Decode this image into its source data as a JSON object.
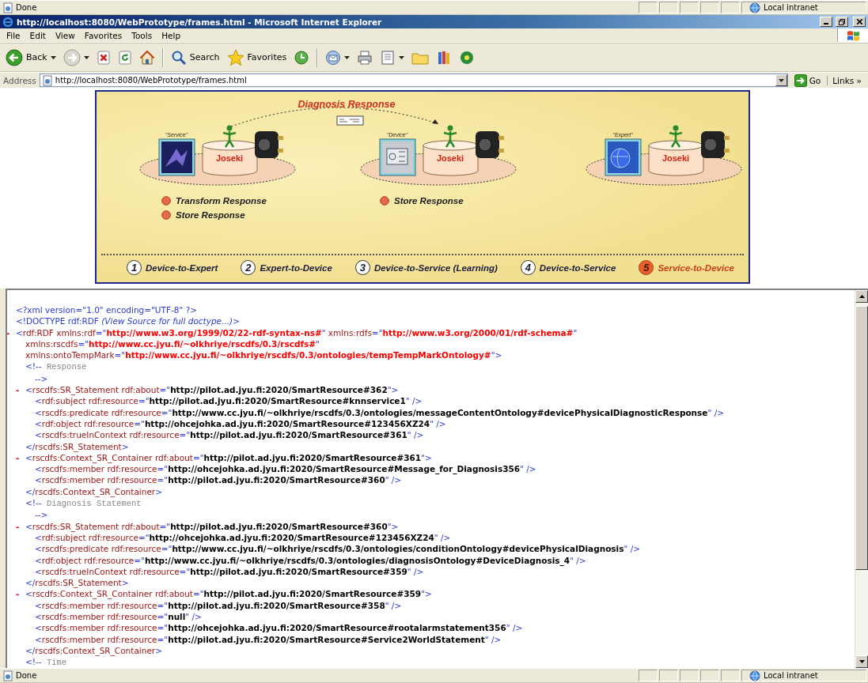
{
  "top_status_bar": {
    "text": "Done",
    "zone": "Local intranet"
  },
  "window": {
    "title": "http://localhost:8080/WebPrototype/frames.html - Microsoft Internet Explorer"
  },
  "menu": [
    "File",
    "Edit",
    "View",
    "Favorites",
    "Tools",
    "Help"
  ],
  "toolbar": [
    {
      "kind": "back",
      "label": "Back",
      "dropdown": true
    },
    {
      "kind": "forward",
      "dropdown": true
    },
    {
      "kind": "stop",
      "dropdown": false
    },
    {
      "kind": "refresh",
      "dropdown": false
    },
    {
      "kind": "home",
      "dropdown": false
    },
    {
      "kind": "separator"
    },
    {
      "kind": "search",
      "label": "Search",
      "dropdown": false
    },
    {
      "kind": "favorites",
      "label": "Favorites",
      "dropdown": false
    },
    {
      "kind": "history",
      "dropdown": false
    },
    {
      "kind": "separator"
    },
    {
      "kind": "mail",
      "dropdown": true
    },
    {
      "kind": "print",
      "dropdown": false
    },
    {
      "kind": "edit",
      "dropdown": true
    },
    {
      "kind": "folder",
      "dropdown": false
    },
    {
      "kind": "research",
      "dropdown": false
    },
    {
      "kind": "messenger",
      "dropdown": false
    }
  ],
  "address_bar": {
    "label": "Address",
    "value": "http://localhost:8080/WebPrototype/frames.html",
    "go": "Go",
    "links": "Links »"
  },
  "diagram": {
    "title": "Diagnosis Response",
    "nodes": [
      {
        "kind": "service",
        "role": "\"Service\"",
        "server": "Joseki",
        "actions": [
          "Transform Response",
          "Store Response"
        ]
      },
      {
        "kind": "device",
        "role": "\"Device\"",
        "server": "Joseki",
        "actions": [
          "Store Response"
        ]
      },
      {
        "kind": "expert",
        "role": "\"Expert\"",
        "server": "Joseki"
      }
    ],
    "steps": [
      {
        "number": "1",
        "label": "Device-to-Expert",
        "selected": false
      },
      {
        "number": "2",
        "label": "Expert-to-Device",
        "selected": false
      },
      {
        "number": "3",
        "label": "Device-to-Service (Learning)",
        "selected": false
      },
      {
        "number": "4",
        "label": "Device-to-Service",
        "selected": false
      },
      {
        "number": "5",
        "label": "Service-to-Device",
        "selected": true
      }
    ]
  },
  "xml_view": {
    "nodes": [
      {
        "lines": [
          [
            {
              "kind": "markup",
              "text": "<?xml version=\"1.0\" encoding=\"UTF-8\" ?>"
            }
          ]
        ]
      },
      {
        "lines": [
          [
            {
              "kind": "markup",
              "text": "<!DOCTYPE rdf:RDF "
            },
            {
              "kind": "note",
              "text": "(View Source for full doctype...)"
            },
            {
              "kind": "markup",
              "text": ">"
            }
          ]
        ]
      },
      {
        "toggle": "-",
        "lines": [
          [
            {
              "kind": "markup",
              "text": "<"
            },
            {
              "kind": "name",
              "text": "rdf:RDF xmlns:rdf"
            },
            {
              "kind": "markup",
              "text": "=\""
            },
            {
              "kind": "ns",
              "text": "http://www.w3.org/1999/02/22-rdf-syntax-ns#"
            },
            {
              "kind": "markup",
              "text": "\""
            },
            {
              "kind": "name",
              "text": " xmlns:rdfs"
            },
            {
              "kind": "markup",
              "text": "=\""
            },
            {
              "kind": "ns",
              "text": "http://www.w3.org/2000/01/rdf-schema#"
            },
            {
              "kind": "markup",
              "text": "\""
            }
          ],
          [
            {
              "kind": "name",
              "text": "xmlns:rscdfs"
            },
            {
              "kind": "markup",
              "text": "=\""
            },
            {
              "kind": "ns",
              "text": "http://www.cc.jyu.fi/~olkhriye/rscdfs/0.3/rscdfs#"
            },
            {
              "kind": "markup",
              "text": "\""
            }
          ],
          [
            {
              "kind": "name",
              "text": "xmlns:ontoTempMark"
            },
            {
              "kind": "markup",
              "text": "=\""
            },
            {
              "kind": "ns",
              "text": "http://www.cc.jyu.fi/~olkhriye/rscdfs/0.3/ontologies/tempTempMarkOntology#"
            },
            {
              "kind": "markup",
              "text": "\">"
            }
          ]
        ],
        "children": [
          {
            "lines": [
              [
                {
                  "kind": "markup",
                  "text": "<!--"
                },
                {
                  "kind": "comment",
                  "text": "  Response"
                }
              ],
              [
                {
                  "kind": "markup",
                  "text": "-->"
                }
              ]
            ]
          },
          {
            "toggle": "-",
            "lines": [
              [
                {
                  "kind": "markup",
                  "text": "<"
                },
                {
                  "kind": "name",
                  "text": "rscdfs:SR_Statement rdf:about"
                },
                {
                  "kind": "markup",
                  "text": "=\""
                },
                {
                  "kind": "value",
                  "text": "http://pilot.ad.jyu.fi:2020/SmartResource#362"
                },
                {
                  "kind": "markup",
                  "text": "\">"
                }
              ]
            ],
            "children": [
              {
                "lines": [
                  [
                    {
                      "kind": "markup",
                      "text": "<"
                    },
                    {
                      "kind": "name",
                      "text": "rdf:subject rdf:resource"
                    },
                    {
                      "kind": "markup",
                      "text": "=\""
                    },
                    {
                      "kind": "value",
                      "text": "http://pilot.ad.jyu.fi:2020/SmartResource#knnservice1"
                    },
                    {
                      "kind": "markup",
                      "text": "\" />"
                    }
                  ]
                ]
              },
              {
                "lines": [
                  [
                    {
                      "kind": "markup",
                      "text": "<"
                    },
                    {
                      "kind": "name",
                      "text": "rscdfs:predicate rdf:resource"
                    },
                    {
                      "kind": "markup",
                      "text": "=\""
                    },
                    {
                      "kind": "value",
                      "text": "http://www.cc.jyu.fi/~olkhriye/rscdfs/0.3/ontologies/messageContentOntology#devicePhysicalDiagnosticResponse"
                    },
                    {
                      "kind": "markup",
                      "text": "\" />"
                    }
                  ]
                ]
              },
              {
                "lines": [
                  [
                    {
                      "kind": "markup",
                      "text": "<"
                    },
                    {
                      "kind": "name",
                      "text": "rdf:object rdf:resource"
                    },
                    {
                      "kind": "markup",
                      "text": "=\""
                    },
                    {
                      "kind": "value",
                      "text": "http://ohcejohka.ad.jyu.fi:2020/SmartResource#123456XZ24"
                    },
                    {
                      "kind": "markup",
                      "text": "\" />"
                    }
                  ]
                ]
              },
              {
                "lines": [
                  [
                    {
                      "kind": "markup",
                      "text": "<"
                    },
                    {
                      "kind": "name",
                      "text": "rscdfs:trueInContext rdf:resource"
                    },
                    {
                      "kind": "markup",
                      "text": "=\""
                    },
                    {
                      "kind": "value",
                      "text": "http://pilot.ad.jyu.fi:2020/SmartResource#361"
                    },
                    {
                      "kind": "markup",
                      "text": "\" />"
                    }
                  ]
                ]
              }
            ],
            "close": [
              {
                "kind": "markup",
                "text": "</"
              },
              {
                "kind": "name",
                "text": "rscdfs:SR_Statement"
              },
              {
                "kind": "markup",
                "text": ">"
              }
            ]
          },
          {
            "toggle": "-",
            "lines": [
              [
                {
                  "kind": "markup",
                  "text": "<"
                },
                {
                  "kind": "name",
                  "text": "rscdfs:Context_SR_Container rdf:about"
                },
                {
                  "kind": "markup",
                  "text": "=\""
                },
                {
                  "kind": "value",
                  "text": "http://pilot.ad.jyu.fi:2020/SmartResource#361"
                },
                {
                  "kind": "markup",
                  "text": "\">"
                }
              ]
            ],
            "children": [
              {
                "lines": [
                  [
                    {
                      "kind": "markup",
                      "text": "<"
                    },
                    {
                      "kind": "name",
                      "text": "rscdfs:member rdf:resource"
                    },
                    {
                      "kind": "markup",
                      "text": "=\""
                    },
                    {
                      "kind": "value",
                      "text": "http://ohcejohka.ad.jyu.fi:2020/SmartResource#Message_for_Diagnosis356"
                    },
                    {
                      "kind": "markup",
                      "text": "\" />"
                    }
                  ]
                ]
              },
              {
                "lines": [
                  [
                    {
                      "kind": "markup",
                      "text": "<"
                    },
                    {
                      "kind": "name",
                      "text": "rscdfs:member rdf:resource"
                    },
                    {
                      "kind": "markup",
                      "text": "=\""
                    },
                    {
                      "kind": "value",
                      "text": "http://pilot.ad.jyu.fi:2020/SmartResource#360"
                    },
                    {
                      "kind": "markup",
                      "text": "\" />"
                    }
                  ]
                ]
              }
            ],
            "close": [
              {
                "kind": "markup",
                "text": "</"
              },
              {
                "kind": "name",
                "text": "rscdfs:Context_SR_Container"
              },
              {
                "kind": "markup",
                "text": ">"
              }
            ]
          },
          {
            "lines": [
              [
                {
                  "kind": "markup",
                  "text": "<!--"
                },
                {
                  "kind": "comment",
                  "text": "  Diagnosis Statement"
                }
              ],
              [
                {
                  "kind": "markup",
                  "text": "-->"
                }
              ]
            ]
          },
          {
            "toggle": "-",
            "lines": [
              [
                {
                  "kind": "markup",
                  "text": "<"
                },
                {
                  "kind": "name",
                  "text": "rscdfs:SR_Statement rdf:about"
                },
                {
                  "kind": "markup",
                  "text": "=\""
                },
                {
                  "kind": "value",
                  "text": "http://pilot.ad.jyu.fi:2020/SmartResource#360"
                },
                {
                  "kind": "markup",
                  "text": "\">"
                }
              ]
            ],
            "children": [
              {
                "lines": [
                  [
                    {
                      "kind": "markup",
                      "text": "<"
                    },
                    {
                      "kind": "name",
                      "text": "rdf:subject rdf:resource"
                    },
                    {
                      "kind": "markup",
                      "text": "=\""
                    },
                    {
                      "kind": "value",
                      "text": "http://ohcejohka.ad.jyu.fi:2020/SmartResource#123456XZ24"
                    },
                    {
                      "kind": "markup",
                      "text": "\" />"
                    }
                  ]
                ]
              },
              {
                "lines": [
                  [
                    {
                      "kind": "markup",
                      "text": "<"
                    },
                    {
                      "kind": "name",
                      "text": "rscdfs:predicate rdf:resource"
                    },
                    {
                      "kind": "markup",
                      "text": "=\""
                    },
                    {
                      "kind": "value",
                      "text": "http://www.cc.jyu.fi/~olkhriye/rscdfs/0.3/ontologies/conditionOntology#devicePhysicalDiagnosis"
                    },
                    {
                      "kind": "markup",
                      "text": "\" />"
                    }
                  ]
                ]
              },
              {
                "lines": [
                  [
                    {
                      "kind": "markup",
                      "text": "<"
                    },
                    {
                      "kind": "name",
                      "text": "rdf:object rdf:resource"
                    },
                    {
                      "kind": "markup",
                      "text": "=\""
                    },
                    {
                      "kind": "value",
                      "text": "http://www.cc.jyu.fi/~olkhriye/rscdfs/0.3/ontologies/diagnosisOntology#DeviceDiagnosis_4"
                    },
                    {
                      "kind": "markup",
                      "text": "\" />"
                    }
                  ]
                ]
              },
              {
                "lines": [
                  [
                    {
                      "kind": "markup",
                      "text": "<"
                    },
                    {
                      "kind": "name",
                      "text": "rscdfs:trueInContext rdf:resource"
                    },
                    {
                      "kind": "markup",
                      "text": "=\""
                    },
                    {
                      "kind": "value",
                      "text": "http://pilot.ad.jyu.fi:2020/SmartResource#359"
                    },
                    {
                      "kind": "markup",
                      "text": "\" />"
                    }
                  ]
                ]
              }
            ],
            "close": [
              {
                "kind": "markup",
                "text": "</"
              },
              {
                "kind": "name",
                "text": "rscdfs:SR_Statement"
              },
              {
                "kind": "markup",
                "text": ">"
              }
            ]
          },
          {
            "toggle": "-",
            "lines": [
              [
                {
                  "kind": "markup",
                  "text": "<"
                },
                {
                  "kind": "name",
                  "text": "rscdfs:Context_SR_Container rdf:about"
                },
                {
                  "kind": "markup",
                  "text": "=\""
                },
                {
                  "kind": "value",
                  "text": "http://pilot.ad.jyu.fi:2020/SmartResource#359"
                },
                {
                  "kind": "markup",
                  "text": "\">"
                }
              ]
            ],
            "children": [
              {
                "lines": [
                  [
                    {
                      "kind": "markup",
                      "text": "<"
                    },
                    {
                      "kind": "name",
                      "text": "rscdfs:member rdf:resource"
                    },
                    {
                      "kind": "markup",
                      "text": "=\""
                    },
                    {
                      "kind": "value",
                      "text": "http://pilot.ad.jyu.fi:2020/SmartResource#358"
                    },
                    {
                      "kind": "markup",
                      "text": "\" />"
                    }
                  ]
                ]
              },
              {
                "lines": [
                  [
                    {
                      "kind": "markup",
                      "text": "<"
                    },
                    {
                      "kind": "name",
                      "text": "rscdfs:member rdf:resource"
                    },
                    {
                      "kind": "markup",
                      "text": "=\""
                    },
                    {
                      "kind": "value",
                      "text": "null"
                    },
                    {
                      "kind": "markup",
                      "text": "\" />"
                    }
                  ]
                ]
              },
              {
                "lines": [
                  [
                    {
                      "kind": "markup",
                      "text": "<"
                    },
                    {
                      "kind": "name",
                      "text": "rscdfs:member rdf:resource"
                    },
                    {
                      "kind": "markup",
                      "text": "=\""
                    },
                    {
                      "kind": "value",
                      "text": "http://ohcejohka.ad.jyu.fi:2020/SmartResource#rootalarmstatement356"
                    },
                    {
                      "kind": "markup",
                      "text": "\" />"
                    }
                  ]
                ]
              },
              {
                "lines": [
                  [
                    {
                      "kind": "markup",
                      "text": "<"
                    },
                    {
                      "kind": "name",
                      "text": "rscdfs:member rdf:resource"
                    },
                    {
                      "kind": "markup",
                      "text": "=\""
                    },
                    {
                      "kind": "value",
                      "text": "http://pilot.ad.jyu.fi:2020/SmartResource#Service2WorldStatement"
                    },
                    {
                      "kind": "markup",
                      "text": "\" />"
                    }
                  ]
                ]
              }
            ],
            "close": [
              {
                "kind": "markup",
                "text": "</"
              },
              {
                "kind": "name",
                "text": "rscdfs:Context_SR_Container"
              },
              {
                "kind": "markup",
                "text": ">"
              }
            ]
          },
          {
            "lines": [
              [
                {
                  "kind": "markup",
                  "text": "<!--"
                },
                {
                  "kind": "comment",
                  "text": "  Time"
                }
              ]
            ]
          }
        ]
      }
    ]
  },
  "status_bar": {
    "text": "Done",
    "zone": "Local intranet"
  }
}
